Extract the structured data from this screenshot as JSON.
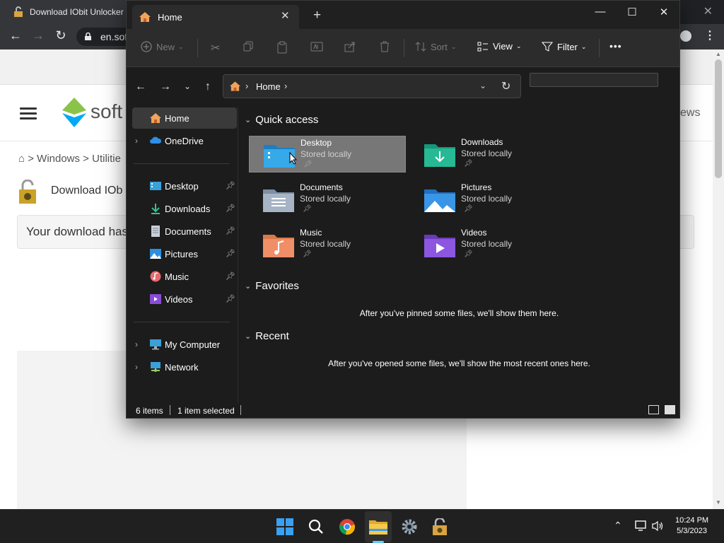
{
  "browser": {
    "tab_title": "Download IObit Unlocker",
    "url": "en.sof",
    "site_name": "soft",
    "site_right_text": "ews",
    "breadcrumb": "> Windows > Utilitie",
    "download_title": "Download IOb",
    "download_box_text": "Your download has"
  },
  "explorer": {
    "tab_label": "Home",
    "new_tab": "+",
    "command_bar": {
      "new_label": "New",
      "sort_label": "Sort",
      "view_label": "View",
      "filter_label": "Filter",
      "more_label": "•••"
    },
    "address": {
      "crumb": "Home",
      "search_placeholder": ""
    },
    "nav": {
      "home": "Home",
      "onedrive": "OneDrive",
      "pinned": [
        {
          "label": "Desktop",
          "icon": "desktop-icon"
        },
        {
          "label": "Downloads",
          "icon": "downloads-icon"
        },
        {
          "label": "Documents",
          "icon": "documents-icon"
        },
        {
          "label": "Pictures",
          "icon": "pictures-icon"
        },
        {
          "label": "Music",
          "icon": "music-icon"
        },
        {
          "label": "Videos",
          "icon": "videos-icon"
        }
      ],
      "my_computer": "My Computer",
      "network": "Network"
    },
    "sections": {
      "quick_access": "Quick access",
      "favorites": "Favorites",
      "recent": "Recent"
    },
    "quick_access": [
      {
        "name": "Desktop",
        "sub": "Stored locally",
        "selected": true
      },
      {
        "name": "Downloads",
        "sub": "Stored locally"
      },
      {
        "name": "Documents",
        "sub": "Stored locally"
      },
      {
        "name": "Pictures",
        "sub": "Stored locally"
      },
      {
        "name": "Music",
        "sub": "Stored locally"
      },
      {
        "name": "Videos",
        "sub": "Stored locally"
      }
    ],
    "favorites_empty": "After you've pinned some files, we'll show them here.",
    "recent_empty": "After you've opened some files, we'll show the most recent ones here.",
    "status": {
      "items": "6 items",
      "selected": "1 item selected"
    }
  },
  "taskbar": {
    "time": "10:24 PM",
    "date": "5/3/2023"
  },
  "colors": {
    "accent": "#60cdff",
    "explorer_bg": "#1c1c1c",
    "selected_item": "#777777"
  }
}
